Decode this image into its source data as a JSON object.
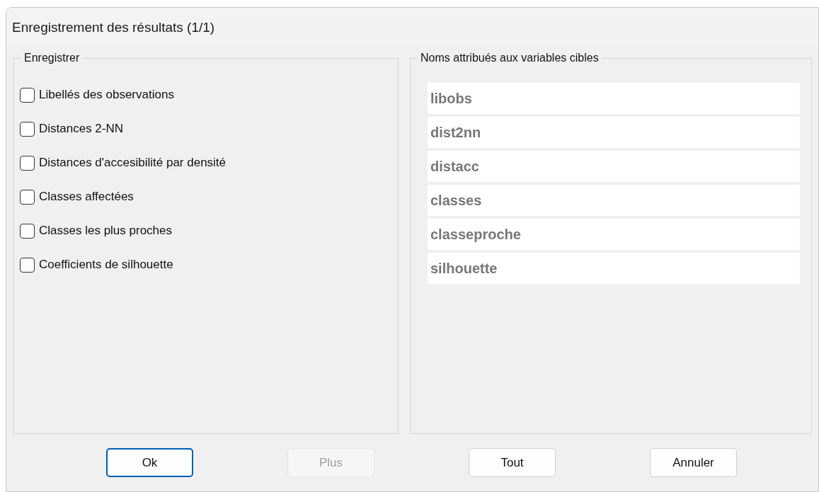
{
  "window": {
    "title": "Enregistrement des résultats (1/1)"
  },
  "save_group": {
    "title": "Enregistrer",
    "options": [
      {
        "label": "Libellés des observations",
        "checked": false
      },
      {
        "label": "Distances 2-NN",
        "checked": false
      },
      {
        "label": "Distances d'accesibilité par densité",
        "checked": false
      },
      {
        "label": "Classes affectées",
        "checked": false
      },
      {
        "label": "Classes les plus proches",
        "checked": false
      },
      {
        "label": "Coefficients de silhouette",
        "checked": false
      }
    ]
  },
  "names_group": {
    "title": "Noms attribués aux variables cibles",
    "fields": [
      {
        "value": "libobs",
        "disabled": true
      },
      {
        "value": "dist2nn",
        "disabled": true
      },
      {
        "value": "distacc",
        "disabled": true
      },
      {
        "value": "classes",
        "disabled": true
      },
      {
        "value": "classeproche",
        "disabled": true
      },
      {
        "value": "silhouette",
        "disabled": true
      }
    ]
  },
  "buttons": [
    {
      "label": "Ok",
      "disabled": false,
      "default": true
    },
    {
      "label": "Plus",
      "disabled": true,
      "default": false
    },
    {
      "label": "Tout",
      "disabled": false,
      "default": false
    },
    {
      "label": "Annuler",
      "disabled": false,
      "default": false
    }
  ]
}
